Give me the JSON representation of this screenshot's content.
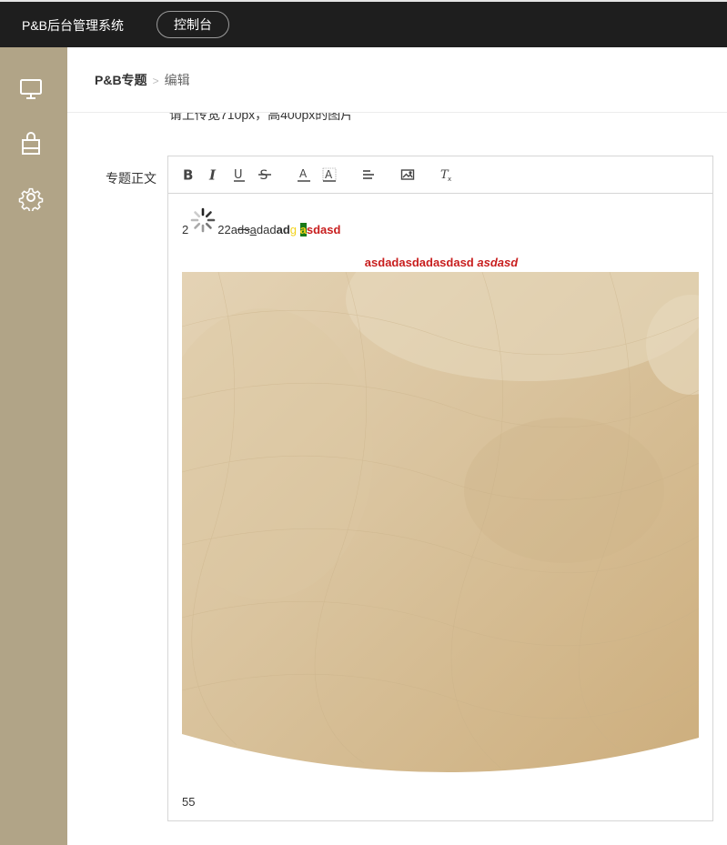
{
  "app": {
    "brand": "P&B后台管理系统",
    "console_button": "控制台"
  },
  "sidebar": {
    "items": [
      {
        "icon": "monitor-icon"
      },
      {
        "icon": "shopping-bag-icon"
      },
      {
        "icon": "gear-icon"
      }
    ]
  },
  "breadcrumb": {
    "section": "P&B专题",
    "separator": ">",
    "current": "编辑"
  },
  "form": {
    "image_hint": "请上传宽710px，高400px的图片",
    "body_label": "专题正文"
  },
  "toolbar": {
    "buttons": [
      "bold-icon",
      "italic-icon",
      "underline-icon",
      "strikethrough-icon",
      "font-color-icon",
      "background-color-icon",
      "align-icon",
      "image-icon",
      "clear-format-icon"
    ]
  },
  "editor": {
    "line1": {
      "a": "2",
      "b": "22a",
      "c": "ds",
      "d": "a",
      "e": "dad",
      "f": "ad",
      "g": "g",
      "h": "a",
      "i": "sdasd"
    },
    "centered": {
      "normal": "asdadasdadasdasd",
      "italic": "asdasd"
    },
    "last_line": "55"
  },
  "colors": {
    "topbar": "#1e1e1e",
    "sidebar": "#b1a487",
    "accent_red": "#c81e1e"
  }
}
